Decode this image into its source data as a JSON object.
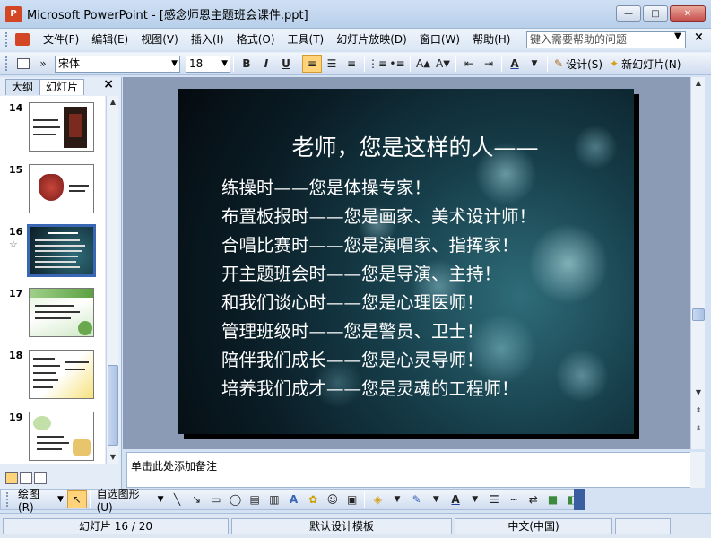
{
  "window": {
    "title": "Microsoft PowerPoint - [感念师恩主题班会课件.ppt]",
    "app_icon_text": "P",
    "minimize": "—",
    "maximize": "□",
    "close": "✕"
  },
  "menu": {
    "items": [
      "文件(F)",
      "编辑(E)",
      "视图(V)",
      "插入(I)",
      "格式(O)",
      "工具(T)",
      "幻灯片放映(D)",
      "窗口(W)",
      "帮助(H)"
    ],
    "help_placeholder": "键入需要帮助的问题",
    "close_glyph": "×"
  },
  "toolbar": {
    "font": "宋体",
    "size": "18",
    "bold": "B",
    "italic": "I",
    "underline": "U",
    "design_label": "设计(S)",
    "new_slide_label": "新幻灯片(N)"
  },
  "left_pane": {
    "tabs": [
      "大纲",
      "幻灯片"
    ],
    "active_tab": "幻灯片",
    "close_glyph": "×",
    "thumbnails": [
      {
        "number": "14"
      },
      {
        "number": "15"
      },
      {
        "number": "16",
        "selected": true,
        "marker": "☆"
      },
      {
        "number": "17"
      },
      {
        "number": "18"
      },
      {
        "number": "19"
      }
    ]
  },
  "slide": {
    "title": "老师，您是这样的人——",
    "lines": [
      "练操时——您是体操专家！",
      "布置板报时——您是画家、美术设计师！",
      "合唱比赛时——您是演唱家、指挥家！",
      "开主题班会时——您是导演、主持！",
      "和我们谈心时——您是心理医师！",
      "管理班级时——您是警员、卫士！",
      "陪伴我们成长——您是心灵导师！",
      "培养我们成才——您是灵魂的工程师！"
    ]
  },
  "notes": {
    "placeholder": "单击此处添加备注"
  },
  "drawbar": {
    "draw_label": "绘图(R)",
    "autoshapes_label": "自选图形(U)"
  },
  "status": {
    "slide_indicator": "幻灯片 16 / 20",
    "template": "默认设计模板",
    "language": "中文(中国)"
  },
  "colors": {
    "accent": "#3a67b4",
    "close_button": "#c75050"
  }
}
